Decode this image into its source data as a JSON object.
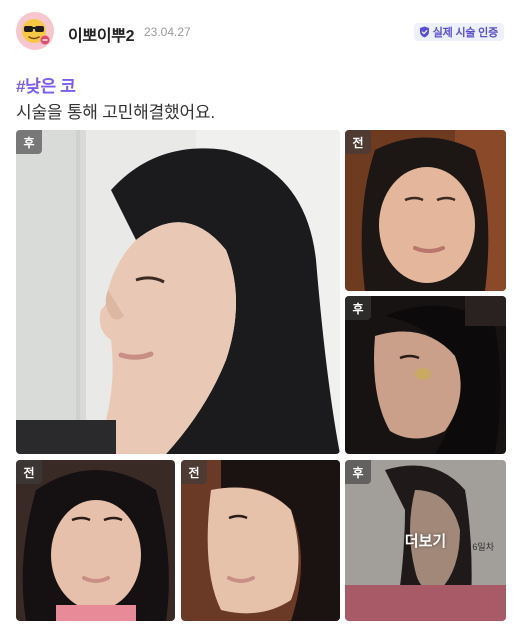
{
  "post": {
    "username": "이뽀이뿌2",
    "date": "23.04.27",
    "badge": "실제 시술 인증",
    "hashtag": "#낮은 코",
    "text": "시술을 통해 고민해결했어요."
  },
  "photos": [
    {
      "tag": "후"
    },
    {
      "tag": "전"
    },
    {
      "tag": "후"
    },
    {
      "tag": "전"
    },
    {
      "tag": "전"
    },
    {
      "tag": "후"
    }
  ],
  "more": {
    "label": "더보기",
    "side_text": "6일차"
  },
  "colors": {
    "accent": "#7a5cf0",
    "badge_text": "#5a4fd6",
    "badge_bg": "#eef0fb"
  },
  "icons": {
    "avatar": "sunglasses-emoji-icon",
    "badge": "verified-shield-icon"
  }
}
